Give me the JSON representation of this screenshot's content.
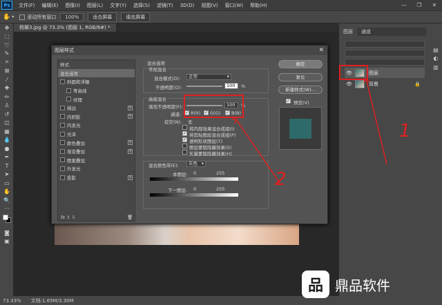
{
  "menubar": {
    "logo": "Ps",
    "items": [
      "文件(F)",
      "编辑(E)",
      "图像(I)",
      "图层(L)",
      "文字(Y)",
      "选择(S)",
      "滤镜(T)",
      "3D(D)",
      "视图(V)",
      "窗口(W)",
      "帮助(H)"
    ],
    "controls": [
      "—",
      "❐",
      "✕"
    ]
  },
  "options": {
    "scroll_all_label": "滚动所有窗口",
    "zoom_value": "100%",
    "fit_screen": "适合屏幕",
    "fill_screen": "填充屏幕"
  },
  "document_tab": "杨幂3.jpg @ 73.3% (图层 1, RGB/8#) *",
  "status": {
    "zoom": "73.33%",
    "doc_size": "文档:1.65M/3.30M"
  },
  "dialog": {
    "title": "图层样式",
    "styles_header": "样式",
    "styles": [
      {
        "label": "混合选项",
        "selected": true,
        "checkbox": false,
        "plus": false,
        "indent": false
      },
      {
        "label": "斜面和浮雕",
        "checkbox": true,
        "plus": false,
        "indent": false
      },
      {
        "label": "等高线",
        "checkbox": true,
        "plus": false,
        "indent": true
      },
      {
        "label": "纹理",
        "checkbox": true,
        "plus": false,
        "indent": true
      },
      {
        "label": "描边",
        "checkbox": true,
        "plus": true,
        "indent": false
      },
      {
        "label": "内阴影",
        "checkbox": true,
        "plus": true,
        "indent": false
      },
      {
        "label": "内发光",
        "checkbox": true,
        "plus": false,
        "indent": false
      },
      {
        "label": "光泽",
        "checkbox": true,
        "plus": false,
        "indent": false
      },
      {
        "label": "颜色叠加",
        "checkbox": true,
        "plus": true,
        "indent": false
      },
      {
        "label": "渐变叠加",
        "checkbox": true,
        "plus": true,
        "indent": false
      },
      {
        "label": "图案叠加",
        "checkbox": true,
        "plus": false,
        "indent": false
      },
      {
        "label": "外发光",
        "checkbox": true,
        "plus": false,
        "indent": false
      },
      {
        "label": "投影",
        "checkbox": true,
        "plus": true,
        "indent": false
      }
    ],
    "footer_icons": "fx  ⇧  ⇩",
    "blend_header": "混合选项",
    "general_group": "常规混合",
    "blend_mode_label": "混合模式(D):",
    "blend_mode_value": "正常",
    "opacity_label": "不透明度(O):",
    "opacity_value": "100",
    "opacity_fraction": 1.0,
    "percent": "%",
    "advanced_group": "高级混合",
    "fill_opacity_label": "填充不透明度(F):",
    "fill_opacity_value": "100",
    "fill_opacity_fraction": 1.0,
    "channels_label": "通道:",
    "channel_r": "R(R)",
    "channel_g": "G(G)",
    "channel_b": "B(B)",
    "knockout_label": "挖空(N):",
    "knockout_value": "无",
    "options": [
      {
        "label": "将内部效果混合成组(I)",
        "checked": false
      },
      {
        "label": "将剪贴图层混合成组(P)",
        "checked": true
      },
      {
        "label": "透明形状图层(T)",
        "checked": true
      },
      {
        "label": "图层蒙版隐藏效果(S)",
        "checked": false
      },
      {
        "label": "矢量蒙版隐藏效果(H)",
        "checked": false
      }
    ],
    "blend_if_label": "混合颜色带(E):",
    "blend_if_value": "灰色",
    "this_layer_label": "本图层:",
    "this_layer_min": "0",
    "this_layer_max": "255",
    "under_layer_label": "下一图层:",
    "under_layer_min": "0",
    "under_layer_max": "255",
    "buttons": {
      "ok": "确定",
      "reset": "复位",
      "new_style": "新建样式(W)...",
      "preview": "预览(V)"
    },
    "preview_color": "#2e6a69"
  },
  "layers_panel": {
    "tabs": [
      "图层",
      "通道"
    ],
    "layers": [
      {
        "name": "图层",
        "selected": true
      },
      {
        "name": "背景",
        "selected": false
      }
    ]
  },
  "annotations": {
    "num1": "1",
    "num2": "2",
    "color": "#e12020"
  },
  "watermark": {
    "text": "鼎品软件",
    "logo": "品"
  }
}
